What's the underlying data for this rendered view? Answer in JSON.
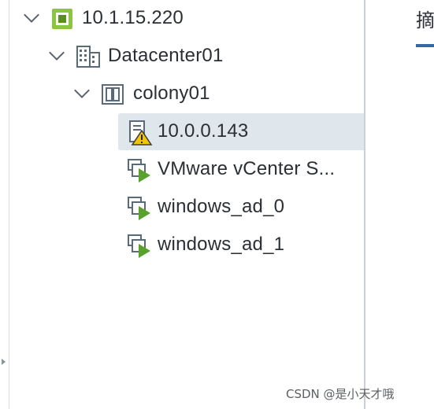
{
  "tree": {
    "vcenter": {
      "label": "10.1.15.220",
      "icon": "vcenter-icon",
      "expanded": true
    },
    "datacenter": {
      "label": "Datacenter01",
      "icon": "datacenter-icon",
      "expanded": true
    },
    "cluster": {
      "label": "colony01",
      "icon": "cluster-icon",
      "expanded": true
    },
    "hosts": [
      {
        "label": "10.0.0.143",
        "icon": "host-warning-icon",
        "selected": true
      },
      {
        "label": "VMware vCenter S...",
        "icon": "vm-powered-on-icon",
        "selected": false
      },
      {
        "label": "windows_ad_0",
        "icon": "vm-powered-on-icon",
        "selected": false
      },
      {
        "label": "windows_ad_1",
        "icon": "vm-powered-on-icon",
        "selected": false
      }
    ]
  },
  "right_panel": {
    "tab_label": "摘"
  },
  "watermark": "CSDN @是小天才哦",
  "colors": {
    "selected_row": "#dfe6ec",
    "vcenter_green": "#8cc63f",
    "vm_play_green": "#5aa02c",
    "warning_yellow": "#f5c400",
    "tab_underline": "#2f6aa6"
  }
}
